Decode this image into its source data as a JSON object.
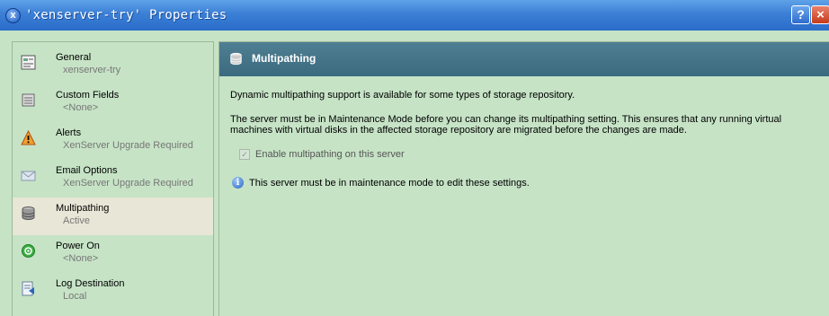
{
  "window": {
    "title": "'xenserver-try' Properties",
    "help_label": "?",
    "close_label": "×",
    "app_icon_label": "x"
  },
  "sidebar": {
    "items": [
      {
        "label": "General",
        "sub": "xenserver-try",
        "icon": "general-icon"
      },
      {
        "label": "Custom Fields",
        "sub": "<None>",
        "icon": "custom-fields-icon"
      },
      {
        "label": "Alerts",
        "sub": "XenServer Upgrade Required",
        "icon": "alert-icon"
      },
      {
        "label": "Email Options",
        "sub": "XenServer Upgrade Required",
        "icon": "email-icon"
      },
      {
        "label": "Multipathing",
        "sub": "Active",
        "icon": "multipathing-icon",
        "active": true
      },
      {
        "label": "Power On",
        "sub": "<None>",
        "icon": "power-icon"
      },
      {
        "label": "Log Destination",
        "sub": "Local",
        "icon": "log-destination-icon"
      }
    ]
  },
  "main": {
    "header_title": "Multipathing",
    "description": "Dynamic multipathing support is available for some types of storage repository.",
    "maintenance_note": "The server must be in Maintenance Mode before you can change its multipathing setting. This ensures that any running virtual machines with virtual disks in the affected storage repository are migrated before the changes are made.",
    "checkbox_label": "Enable multipathing on this server",
    "checkbox_checked": true,
    "checkbox_enabled": false,
    "info_icon_label": "i",
    "info_text": "This server must be in maintenance mode to edit these settings."
  },
  "colors": {
    "titlebar": "#3b7fd6",
    "background": "#c6e3c6",
    "header": "#3b6a7e",
    "active_item": "#e8e6d6"
  }
}
